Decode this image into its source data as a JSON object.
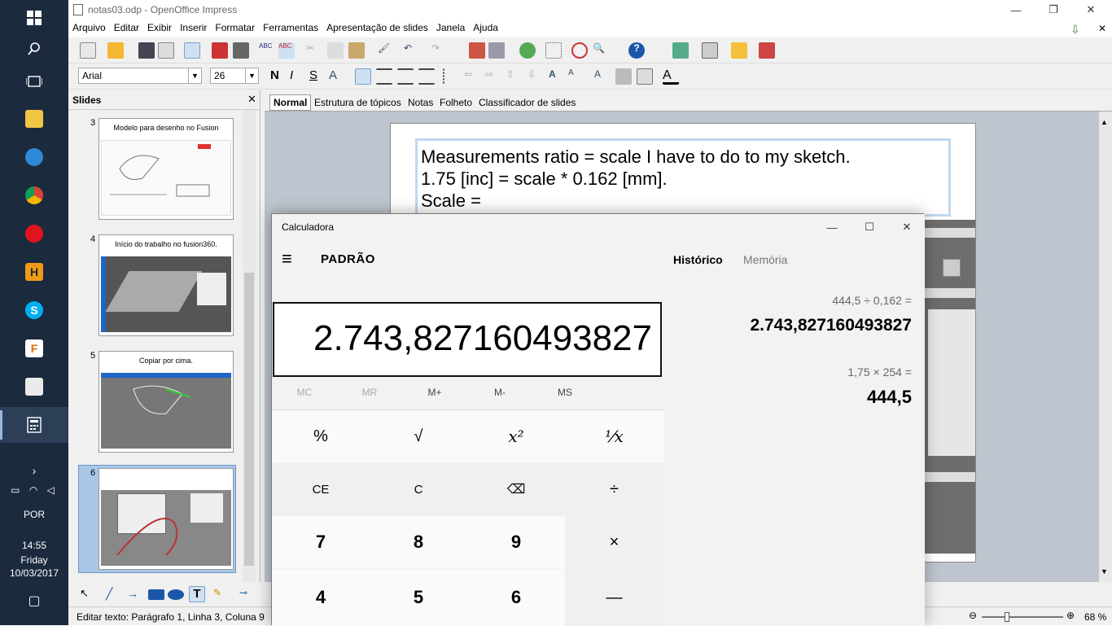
{
  "taskbar": {
    "tray_lang": "POR",
    "time": "14:55",
    "day": "Friday",
    "date": "10/03/2017"
  },
  "window": {
    "title": "notas03.odp - OpenOffice Impress"
  },
  "menu": [
    "Arquivo",
    "Editar",
    "Exibir",
    "Inserir",
    "Formatar",
    "Ferramentas",
    "Apresentação de slides",
    "Janela",
    "Ajuda"
  ],
  "format_bar": {
    "font_name": "Arial",
    "font_size": "26"
  },
  "slides_panel": {
    "title": "Slides",
    "items": [
      {
        "num": "3",
        "title": "Modelo para desenho no Fusion"
      },
      {
        "num": "4",
        "title": "Início do trabalho no fusion360."
      },
      {
        "num": "5",
        "title": "Copiar por cima."
      },
      {
        "num": "6",
        "title": ""
      }
    ]
  },
  "view_tabs": [
    "Normal",
    "Estrutura de tópicos",
    "Notas",
    "Folheto",
    "Classificador de slides"
  ],
  "slide": {
    "line1": "Measurements ratio = scale I have to do to my sketch.",
    "line2": "1.75 [inc] = scale * 0.162 [mm].",
    "line3": "Scale ="
  },
  "status": {
    "text": "Editar texto: Parágrafo 1, Linha 3, Coluna 9",
    "zoom": "68 %"
  },
  "calculator": {
    "title": "Calculadora",
    "mode": "PADRÃO",
    "display": "2.743,827160493827",
    "memory": [
      "MC",
      "MR",
      "M+",
      "M-",
      "MS"
    ],
    "keys_row1": [
      "%",
      "√",
      "x²",
      "¹⁄x"
    ],
    "keys_row2": [
      "CE",
      "C",
      "⌫",
      "÷"
    ],
    "keys_row3": [
      "7",
      "8",
      "9",
      "×"
    ],
    "keys_row4": [
      "4",
      "5",
      "6",
      "—"
    ],
    "tabs": {
      "history": "Histórico",
      "memory": "Memória"
    },
    "history": [
      {
        "expr": "444,5   ÷   0,162 =",
        "result": "2.743,827160493827"
      },
      {
        "expr": "1,75   ×   254 =",
        "result": "444,5"
      }
    ]
  }
}
